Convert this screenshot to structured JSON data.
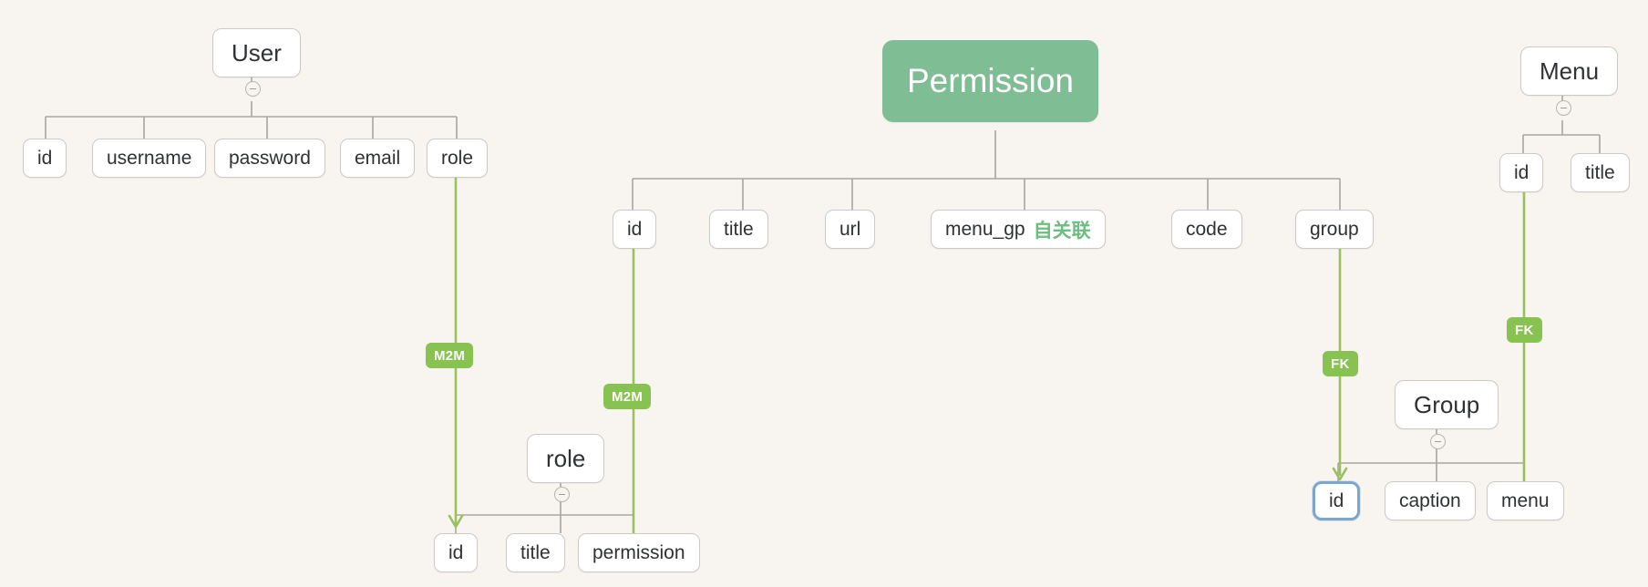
{
  "diagram": {
    "title": "Permission model relationship diagram",
    "background_color": "#f8f4f0",
    "accent_color": "#7fbd95",
    "relation_color": "#88c352",
    "selected_color": "#7aa7cb",
    "self_relation_color": "#6cbd7e"
  },
  "trees": {
    "user": {
      "root": {
        "label": "User"
      },
      "children": [
        {
          "label": "id"
        },
        {
          "label": "username"
        },
        {
          "label": "password"
        },
        {
          "label": "email"
        },
        {
          "label": "role"
        }
      ]
    },
    "permission": {
      "root": {
        "label": "Permission"
      },
      "children": [
        {
          "label": "id"
        },
        {
          "label": "title"
        },
        {
          "label": "url"
        },
        {
          "label": "menu_gp",
          "self_rel": "自关联"
        },
        {
          "label": "code"
        },
        {
          "label": "group"
        }
      ]
    },
    "menu": {
      "root": {
        "label": "Menu"
      },
      "children": [
        {
          "label": "id"
        },
        {
          "label": "title"
        }
      ]
    },
    "role": {
      "root": {
        "label": "role"
      },
      "children": [
        {
          "label": "id"
        },
        {
          "label": "title"
        },
        {
          "label": "permission"
        }
      ]
    },
    "group": {
      "root": {
        "label": "Group"
      },
      "children": [
        {
          "label": "id",
          "selected": true
        },
        {
          "label": "caption"
        },
        {
          "label": "menu"
        }
      ]
    }
  },
  "relations": [
    {
      "id": "user-role-m2m",
      "label": "M2M",
      "from": "User.role",
      "to": "role.id"
    },
    {
      "id": "role-permission-m2m",
      "label": "M2M",
      "from": "role.permission",
      "to": "Permission.id"
    },
    {
      "id": "permission-group-fk",
      "label": "FK",
      "from": "Permission.group",
      "to": "Group.id"
    },
    {
      "id": "group-menu-fk",
      "label": "FK",
      "from": "Group.menu",
      "to": "Menu.id"
    }
  ]
}
